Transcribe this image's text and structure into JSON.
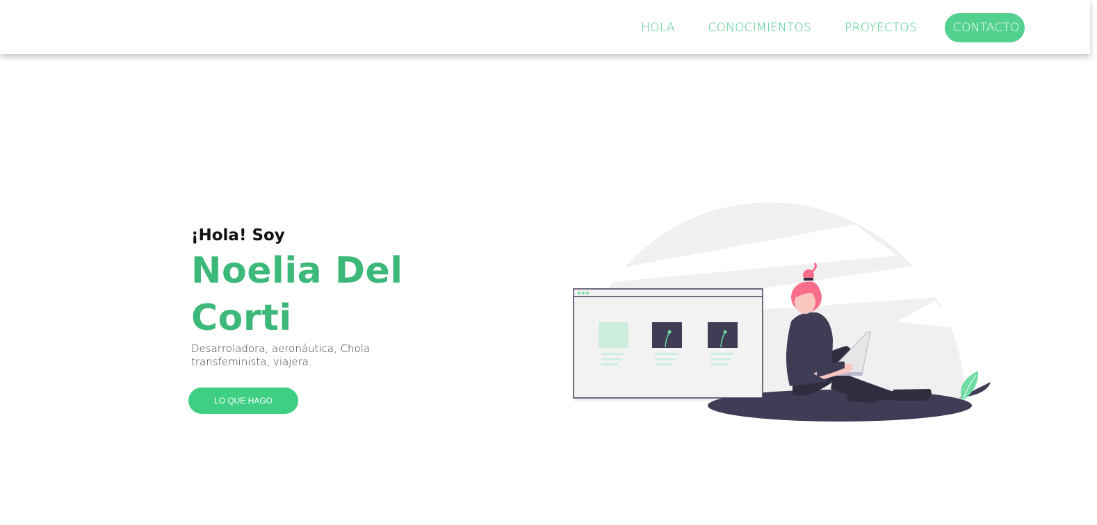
{
  "nav": {
    "links": [
      "HOLA",
      "CONOCIMIENTOS",
      "PROYECTOS"
    ],
    "contact_label": "CONTACTO"
  },
  "hero": {
    "greeting": "¡Hola! Soy",
    "name_line1": "Noelia Del",
    "name_line2": "Corti",
    "subtitle": "Desarroladora, aeronáutica, Chola transfeminista, viajera.",
    "button_label": "LO QUE HAGO"
  },
  "colors": {
    "accent": "#3cb878",
    "button": "#3ecf85",
    "dark": "#3f3d56",
    "hair": "#f86d8a"
  },
  "icons": [
    "person-with-laptop-illustration",
    "leaf-icon"
  ]
}
